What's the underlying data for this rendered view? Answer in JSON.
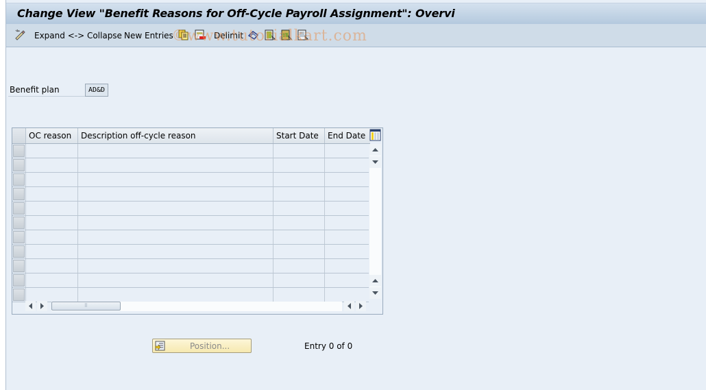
{
  "window": {
    "title": "Change View \"Benefit Reasons for Off-Cycle Payroll Assignment\": Overvi"
  },
  "toolbar": {
    "expand_collapse_label": "Expand <-> Collapse",
    "new_entries_label": "New Entries",
    "delimit_label": "Delimit",
    "icons": [
      "display-change-icon",
      "copy-icon",
      "delete-icon",
      "undo-icon",
      "select-all-icon",
      "select-block-icon",
      "deselect-all-icon"
    ]
  },
  "watermark": "©www.tutorialkart.com",
  "form": {
    "benefit_plan_label": "Benefit plan",
    "benefit_plan_value": "AD&D"
  },
  "table": {
    "columns": [
      "OC reason",
      "Description off-cycle reason",
      "Start Date",
      "End Date"
    ],
    "rows": [
      [
        "",
        "",
        "",
        ""
      ],
      [
        "",
        "",
        "",
        ""
      ],
      [
        "",
        "",
        "",
        ""
      ],
      [
        "",
        "",
        "",
        ""
      ],
      [
        "",
        "",
        "",
        ""
      ],
      [
        "",
        "",
        "",
        ""
      ],
      [
        "",
        "",
        "",
        ""
      ],
      [
        "",
        "",
        "",
        ""
      ],
      [
        "",
        "",
        "",
        ""
      ],
      [
        "",
        "",
        "",
        ""
      ],
      [
        "",
        "",
        "",
        ""
      ]
    ]
  },
  "footer": {
    "position_button_label": "Position...",
    "entry_text": "Entry 0 of 0"
  },
  "colors": {
    "background": "#e8eff7",
    "titlebar": "#c4d5e6",
    "toolbar": "#cfdce8",
    "position_button": "#f8edbe"
  }
}
